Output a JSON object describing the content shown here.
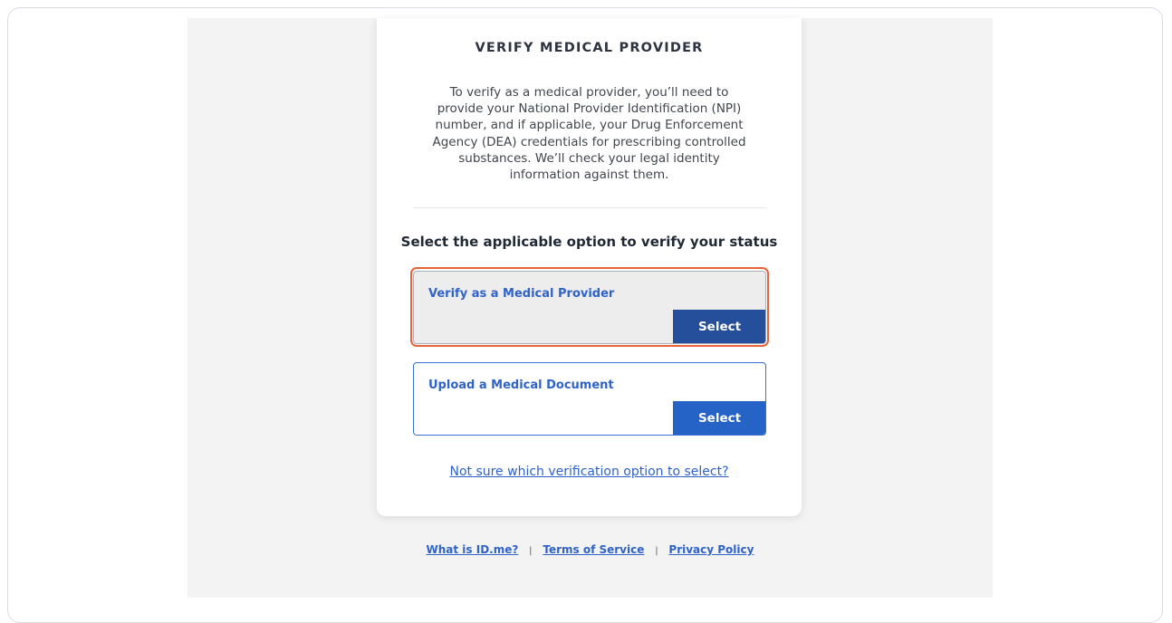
{
  "card": {
    "title": "VERIFY MEDICAL PROVIDER",
    "description_lines": [
      "To verify as a medical provider, you’ll need to",
      "provide your National Provider Identification (NPI)",
      "number, and if applicable, your Drug Enforcement",
      "Agency (DEA) credentials for prescribing controlled",
      "substances. We’ll check your legal identity",
      "information against them."
    ],
    "prompt": "Select the applicable option to verify your status",
    "options": [
      {
        "label": "Verify as a Medical Provider",
        "button": "Select",
        "state": "focused"
      },
      {
        "label": "Upload a Medical Document",
        "button": "Select",
        "state": "default"
      }
    ],
    "help_link": "Not sure which verification option to select?"
  },
  "footer": {
    "links": [
      "What is ID.me?",
      "Terms of Service",
      "Privacy Policy"
    ],
    "separator": "|"
  },
  "colors": {
    "accent": "#2f63c8",
    "focus_ring": "#e8633a",
    "button_dark": "#254f9a",
    "button": "#2563c7"
  }
}
